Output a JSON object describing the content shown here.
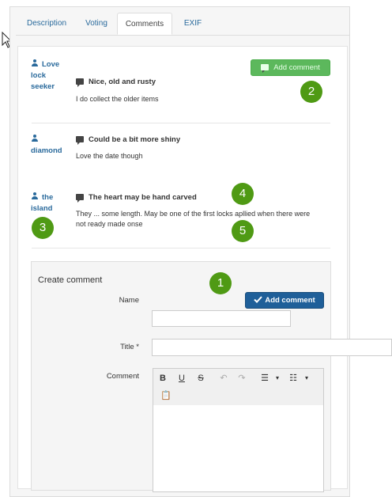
{
  "tabs": [
    {
      "label": "Description"
    },
    {
      "label": "Voting"
    },
    {
      "label": "Comments"
    },
    {
      "label": "EXIF"
    }
  ],
  "add_comment_top_label": "Add comment",
  "comments": [
    {
      "author": "Love lock seeker",
      "title": "Nice, old and rusty",
      "text": "I do collect the older items"
    },
    {
      "author": "diamond",
      "title": "Could be a bit more shiny",
      "text": "Love the date though"
    },
    {
      "author": "the island",
      "title": "The heart may be hand carved",
      "text": "They ... some length. May be one of the first locks apllied when there were not ready made onse"
    }
  ],
  "badges": [
    "1",
    "2",
    "3",
    "4",
    "5"
  ],
  "form": {
    "heading": "Create comment",
    "submit_label": "Add comment",
    "name_label": "Name",
    "title_label": "Title *",
    "comment_label": "Comment"
  },
  "toolbar": [
    "bold-icon",
    "underline-icon",
    "strikethrough-icon",
    "undo-icon",
    "redo-icon",
    "bulleted-list-icon",
    "numbered-list-icon",
    "paste-icon"
  ],
  "colors": {
    "accent_green": "#5cb85c",
    "badge_green": "#4f9a14",
    "primary_blue": "#1f5f99",
    "link_blue": "#2a6a9c"
  }
}
